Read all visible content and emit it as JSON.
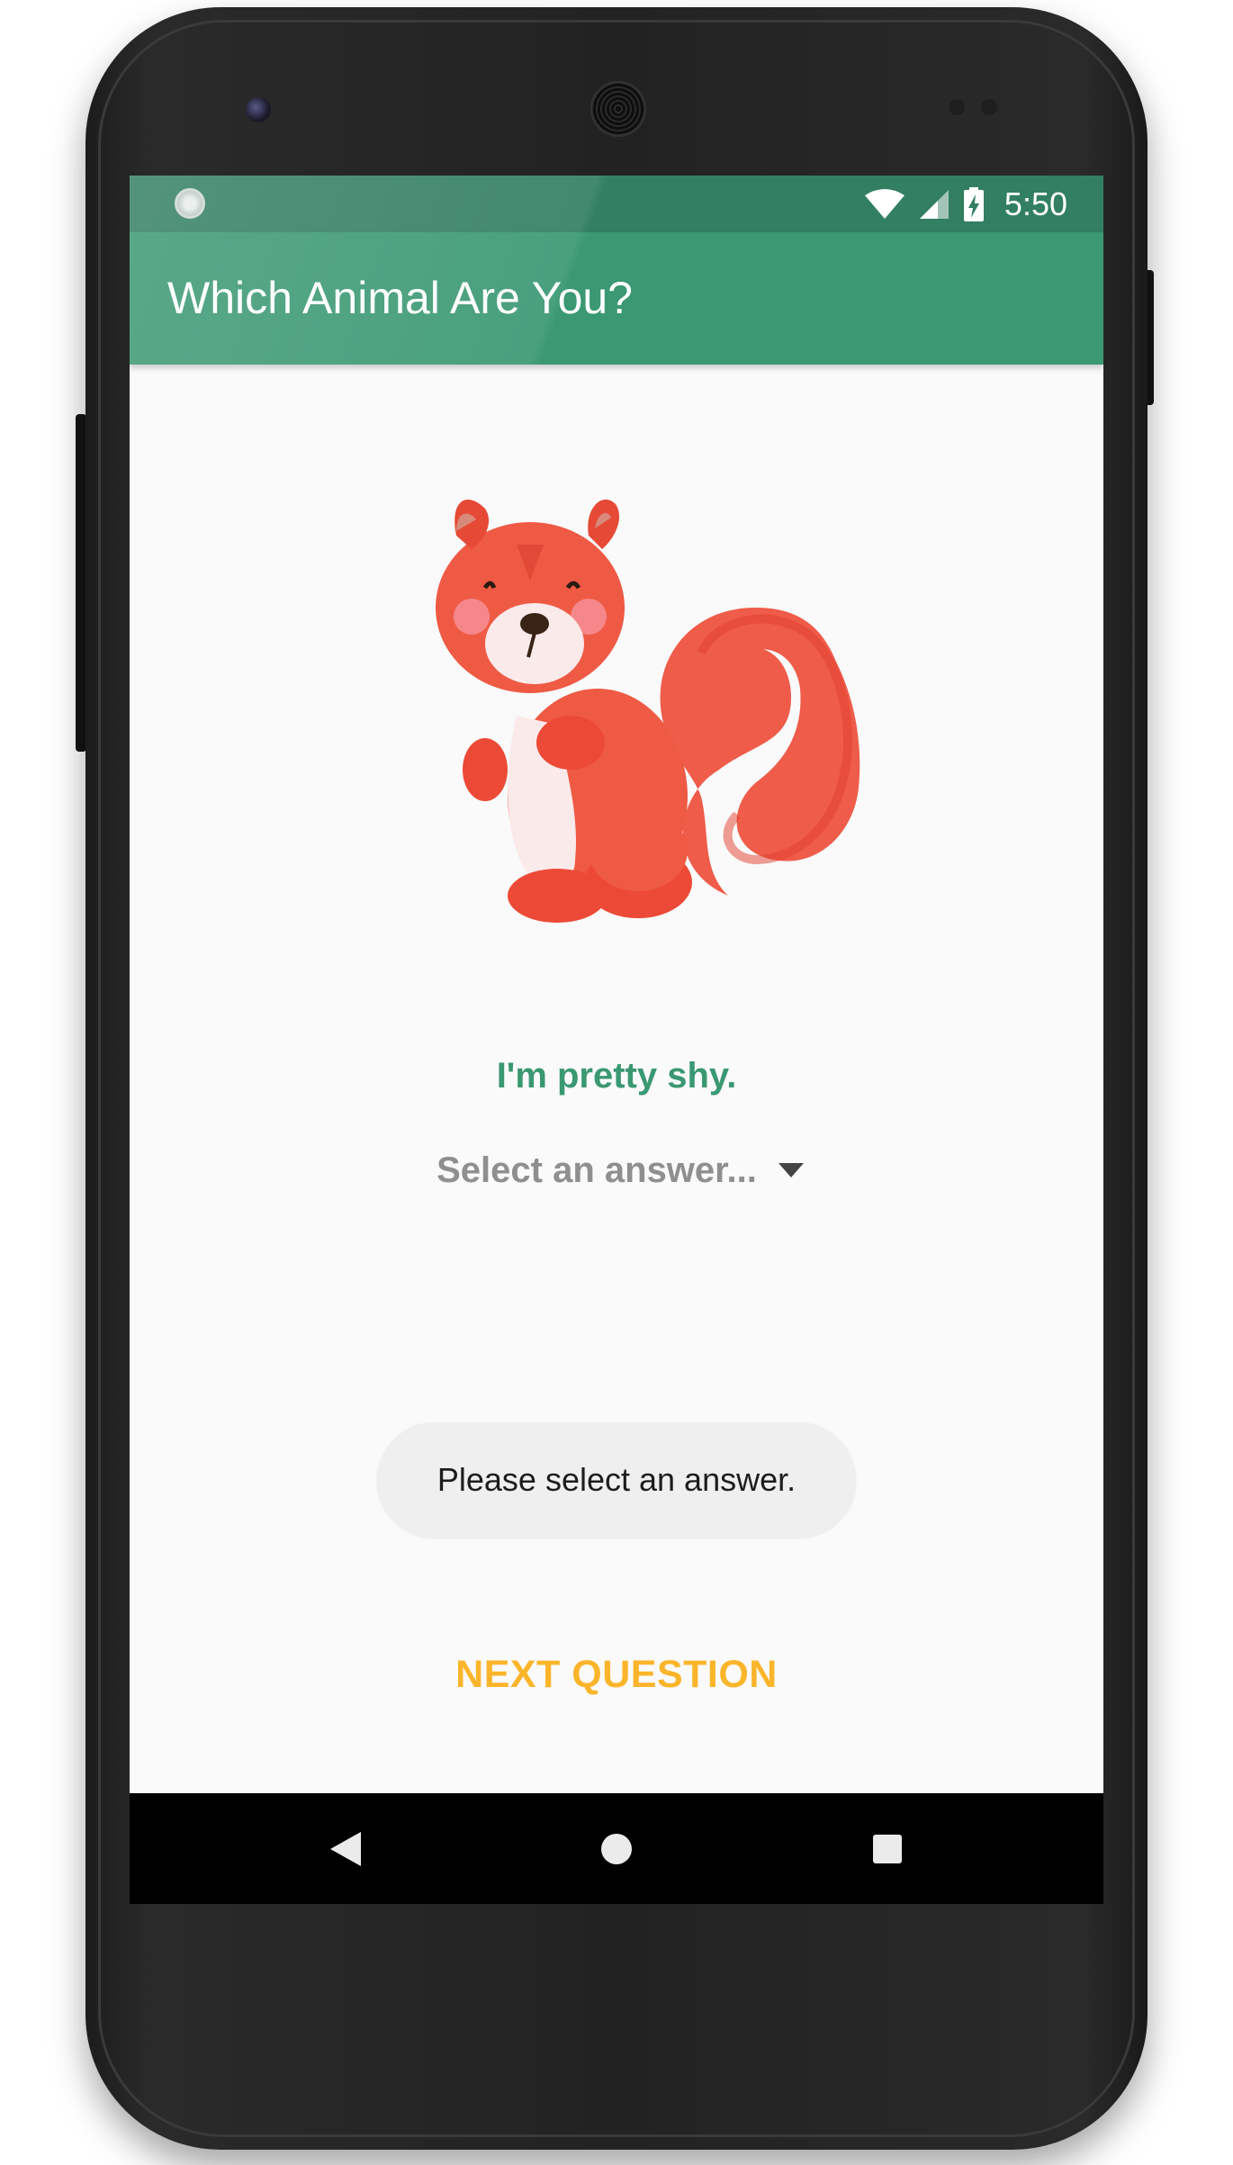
{
  "status_bar": {
    "time": "5:50",
    "icons": [
      "sync-icon",
      "wifi-icon",
      "signal-icon",
      "battery-charging-icon"
    ]
  },
  "app_bar": {
    "title": "Which Animal Are You?"
  },
  "content": {
    "image": "squirrel-illustration",
    "question": "I'm pretty shy.",
    "answer_spinner": {
      "selected": "Select an answer...",
      "icon": "dropdown-arrow-icon"
    },
    "toast": "Please select an answer.",
    "next_button": "NEXT QUESTION"
  },
  "nav_bar": {
    "buttons": [
      "back-icon",
      "home-icon",
      "recents-icon"
    ]
  },
  "colors": {
    "status_bar": "#327f62",
    "app_bar": "#3a9872",
    "question_text": "#3a9872",
    "accent_button": "#fbb52a",
    "background": "#fafafa"
  }
}
